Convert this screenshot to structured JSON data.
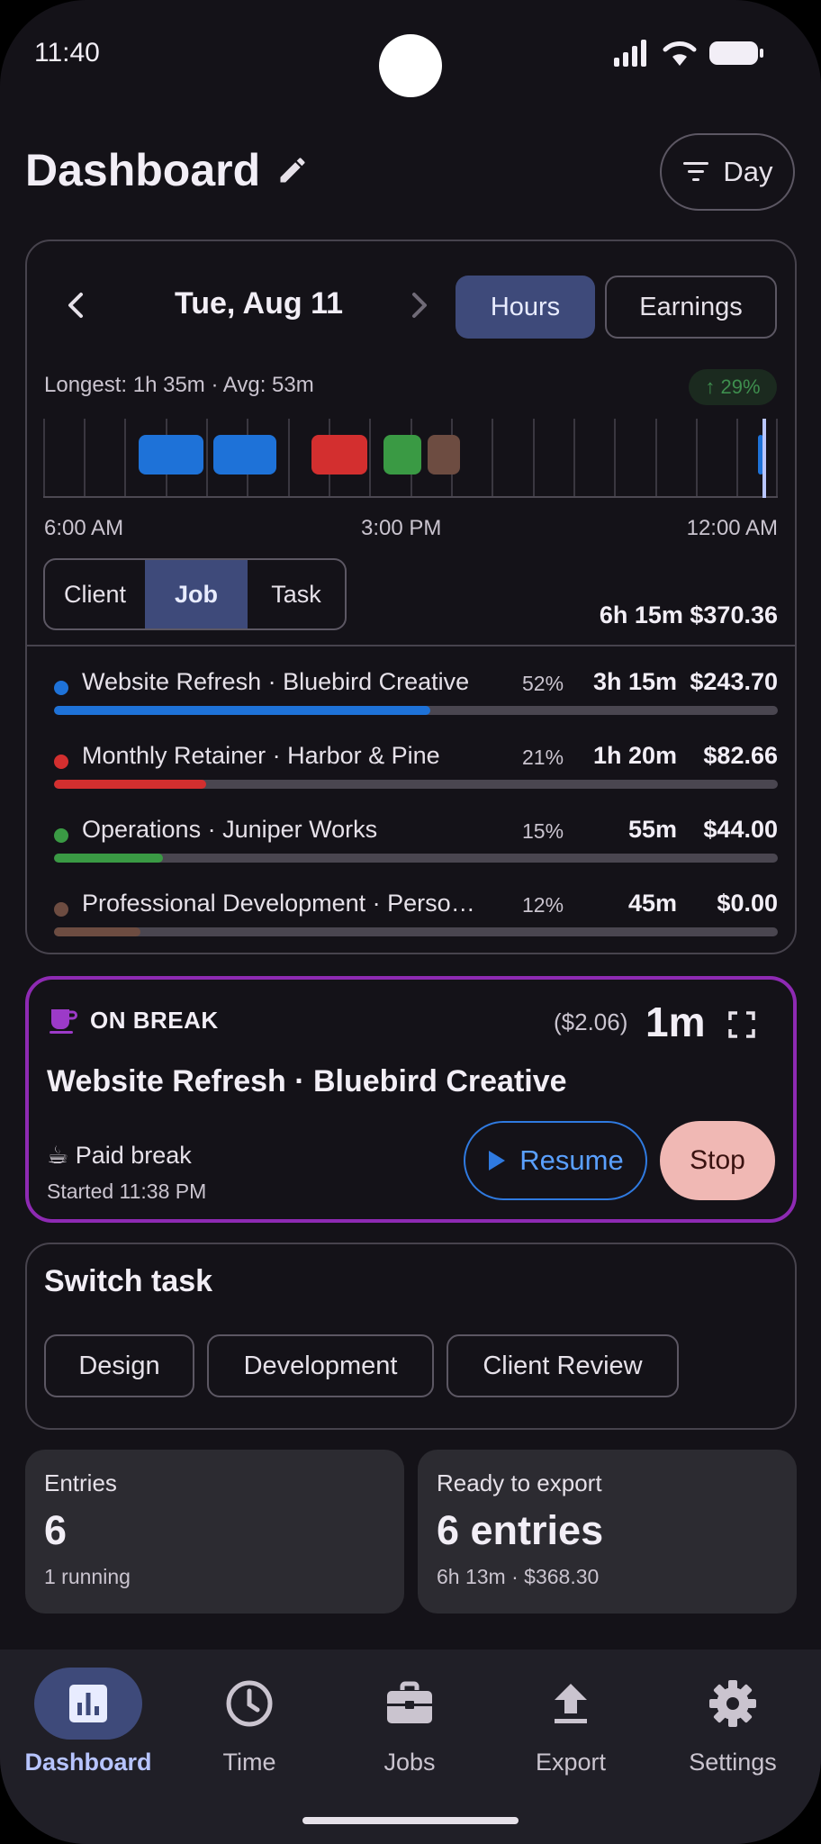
{
  "status": {
    "time": "11:40"
  },
  "header": {
    "title": "Dashboard",
    "filter_label": "Day"
  },
  "chart": {
    "date": "Tue, Aug 11",
    "tabs": {
      "hours": "Hours",
      "earnings": "Earnings"
    },
    "stats": "Longest: 1h 35m · Avg: 53m",
    "trend": "↑ 29%",
    "axis": {
      "start": "6:00 AM",
      "mid": "3:00 PM",
      "end": "12:00 AM"
    },
    "group_by": {
      "client": "Client",
      "job": "Job",
      "task": "Task"
    },
    "totals": "6h 15m $370.36"
  },
  "chart_data": {
    "type": "bar",
    "categories": [
      "Website Refresh · Bluebird Creative",
      "Monthly Retainer · Harbor & Pine",
      "Operations · Juniper Works",
      "Professional Development · Perso…"
    ],
    "percent": [
      "52%",
      "21%",
      "15%",
      "12%"
    ],
    "durations": [
      "3h 15m",
      "1h 20m",
      "55m",
      "45m"
    ],
    "amounts": [
      "$243.70",
      "$82.66",
      "$44.00",
      "$0.00"
    ],
    "values": [
      0.52,
      0.21,
      0.15,
      0.12
    ],
    "colors": [
      "#1e72d8",
      "#d32f2f",
      "#3a9a44",
      "#6d4c41"
    ]
  },
  "break": {
    "status": "ON BREAK",
    "cost": "($2.06)",
    "duration": "1m",
    "job": "Website Refresh · Bluebird Creative",
    "type": "☕ Paid break",
    "started": "Started 11:38 PM",
    "resume_label": "Resume",
    "stop_label": "Stop",
    "accent": "#8e2ab3"
  },
  "switch_task": {
    "title": "Switch task",
    "tasks": [
      "Design",
      "Development",
      "Client Review"
    ]
  },
  "summary": {
    "entries": {
      "label": "Entries",
      "value": "6",
      "sub": "1 running"
    },
    "export": {
      "label": "Ready to export",
      "value": "6 entries",
      "sub": "6h 13m · $368.30"
    }
  },
  "nav": {
    "dashboard": "Dashboard",
    "time": "Time",
    "jobs": "Jobs",
    "export": "Export",
    "settings": "Settings"
  }
}
